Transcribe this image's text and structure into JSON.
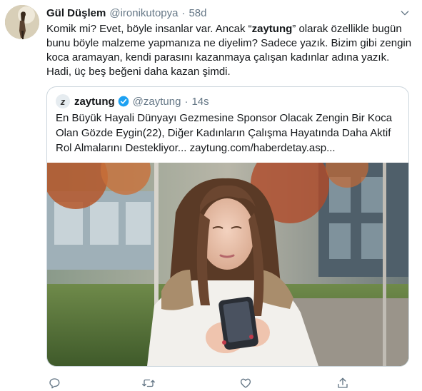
{
  "tweet": {
    "display_name": "Gül Düşlem",
    "handle": "@ironikutopya",
    "separator": "·",
    "time": "58d",
    "text_before": "Komik mi? Evet, böyle insanlar var. Ancak “",
    "text_bold": "zaytung",
    "text_after": "” olarak özellikle bugün bunu böyle malzeme yapmanıza ne diyelim? Sadece yazık. Bizim gibi zengin koca aramayan, kendi parasını kazanmaya çalışan kadınlar adına yazık. Hadi, üç beş beğeni daha kazan şimdi."
  },
  "quote": {
    "display_name": "zaytung",
    "handle": "@zaytung",
    "separator": "·",
    "time": "14s",
    "text": "En Büyük Hayali Dünyayı Gezmesine Sponsor Olacak Zengin Bir Koca Olan Gözde Eygin(22), Diğer Kadınların Çalışma Hayatında Daha Aktif Rol Almalarını Destekliyor... zaytung.com/haberdetay.asp...",
    "avatar_letter": "z"
  },
  "icons": {
    "caret": "chevron-down-icon",
    "verified": "verified-badge-icon",
    "reply": "reply-icon",
    "retweet": "retweet-icon",
    "like": "like-icon",
    "share": "share-icon"
  },
  "colors": {
    "text": "#14171a",
    "secondary": "#657786",
    "accent": "#1da1f2",
    "border": "#ccd6dd"
  }
}
